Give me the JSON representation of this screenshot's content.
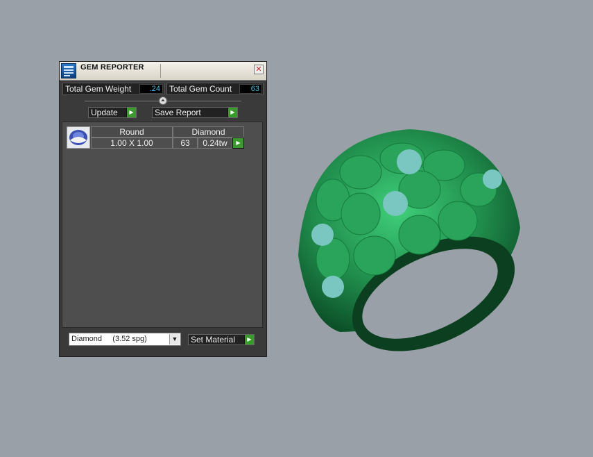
{
  "panel": {
    "title": "GEM REPORTER",
    "close_glyph": "✕",
    "total_weight_label": "Total Gem Weight",
    "total_weight_value": ".24",
    "total_count_label": "Total Gem Count",
    "total_count_value": "63",
    "update_label": "Update",
    "save_report_label": "Save Report",
    "arrow_glyph": "▶",
    "collapse_glyph": "⏶"
  },
  "gem_table": {
    "headers": [
      "Round",
      "Diamond"
    ],
    "rows": [
      {
        "size": "1.00 X 1.00",
        "count": "63",
        "weight": "0.24tw"
      }
    ]
  },
  "footer": {
    "material_selected": "Diamond     (3.52 spg)",
    "dropdown_glyph": "▼",
    "set_material_label": "Set Material"
  },
  "icons": {
    "title": "gem-reporter-icon",
    "thumb": "round-diamond-icon"
  },
  "colors": {
    "background": "#9aa0a8",
    "ring": "#1f8a4a",
    "accent_green": "#3a9a2e",
    "value_text": "#4ec0e6"
  }
}
